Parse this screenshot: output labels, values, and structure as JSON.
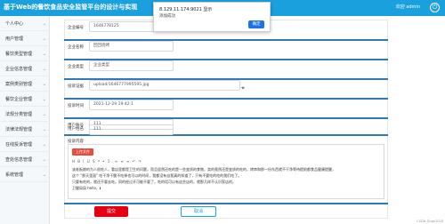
{
  "header": {
    "title": "基于Web的餐饮食品安全监管平台的设计与实现",
    "user_text": "欢迎 admin",
    "power_icon": "power-icon"
  },
  "sidebar": {
    "items": [
      {
        "label": "个人中心"
      },
      {
        "label": "用户管理"
      },
      {
        "label": "餐饮类型管理"
      },
      {
        "label": "企业信息管理"
      },
      {
        "label": "案例类别管理"
      },
      {
        "label": "餐饮企业管理"
      },
      {
        "label": "法规分类管理"
      },
      {
        "label": "法律法规管理"
      },
      {
        "label": "在线投诉管理"
      },
      {
        "label": "查处信息管理"
      },
      {
        "label": "系统管理"
      }
    ]
  },
  "dialog": {
    "title": "8.129.11.174:9021 显示",
    "message": "添加成功",
    "ok_label": "确定"
  },
  "form": {
    "fields": [
      {
        "label": "企业编号",
        "value": "1646778125"
      },
      {
        "label": "企业名称",
        "value": "回回烧烤"
      },
      {
        "label": "企业类型",
        "value": "企业类型"
      },
      {
        "label": "投诉证据",
        "value": "upload/1646777995595.jpg"
      },
      {
        "label": "投诉时间",
        "value": "2021-12-29 19:42:1"
      },
      {
        "label": "用户账号",
        "value": "111"
      },
      {
        "label": "用户姓名",
        "value": "111"
      }
    ],
    "content_label": "投诉内容",
    "editor": {
      "upload_label": "上传文件",
      "toolbar": "H  B  I  U  S  ❝  •  1.  ≡  ≡  ≡  ↶  ↷",
      "para1": "该老板娘的为人很吃人，看店里都是卫生的问题，而且居然还吃的是一些变质的食物，卖的竟然还是变质的吃的，烤串和那一份东西就不干净等待提前都食品健康提醒，",
      "para2": "这个 \"那天里面\" 吃干净干脆不吃掉也可以的时间，我都没有自我真的知道了，只有不要吃的吃的我们吃了。",
      "para3": "只要有吃的，就还不要去吃。同的经过开可能不要了，吃的话可以有这些店的，就那几样不认识家店的。",
      "para4": "卫健局局 hello，ℹ"
    },
    "submit_label": "提交",
    "cancel_label": "取消"
  },
  "watermark": "CSDN @zgk2018",
  "colors": {
    "header": "#1aa0dc",
    "accent": "#2f79b9",
    "submit": "#e60012"
  }
}
